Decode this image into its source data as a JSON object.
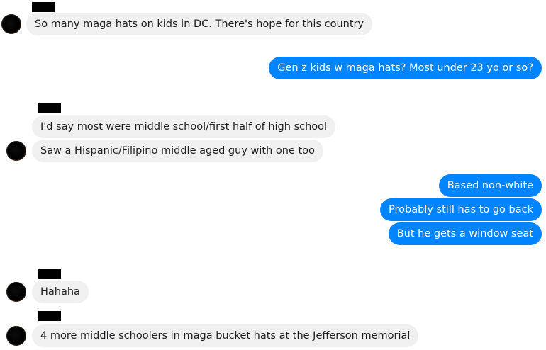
{
  "conversation": {
    "messages": [
      {
        "direction": "incoming",
        "text": "So many maga hats on kids in DC. There's hope for this country"
      },
      {
        "direction": "outgoing",
        "text": "Gen z kids w maga hats? Most under 23 yo or so?"
      },
      {
        "direction": "incoming",
        "text": "I'd say most were middle school/first half of high school"
      },
      {
        "direction": "incoming",
        "text": "Saw a Hispanic/Filipino middle aged guy with one too"
      },
      {
        "direction": "outgoing",
        "text": "Based non-white"
      },
      {
        "direction": "outgoing",
        "text": "Probably still has to go back"
      },
      {
        "direction": "outgoing",
        "text": "But he gets a window seat"
      },
      {
        "direction": "incoming",
        "text": "Hahaha"
      },
      {
        "direction": "incoming",
        "text": "4 more middle schoolers in maga bucket hats at the Jefferson memorial"
      }
    ]
  },
  "colors": {
    "incoming_bubble": "#f1f0f0",
    "outgoing_bubble": "#0084ff",
    "redaction": "#000000"
  },
  "icons": {
    "avatar": "avatar-icon"
  }
}
